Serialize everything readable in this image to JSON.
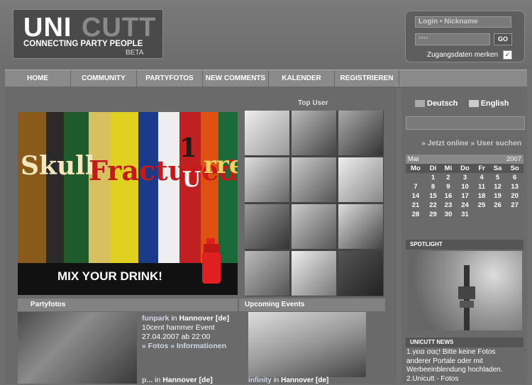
{
  "logo": {
    "uni": "UNI",
    "cutt": "CUTT",
    "tagline": "CONNECTING PARTY PEOPLE",
    "beta": "BETA"
  },
  "login": {
    "nickname_placeholder": "Login • Nickname",
    "password_value": "****",
    "go_label": "GO",
    "remember_label": "Zugangsdaten merken",
    "remember_checked": true
  },
  "nav": [
    "HOME",
    "COMMUNITY",
    "PARTYFOTOS",
    "NEW COMMENTS",
    "KALENDER",
    "REGISTRIEREN"
  ],
  "banner": {
    "text": "MIX YOUR DRINK!",
    "brands": [
      "Skull",
      "Fractured",
      "1",
      "U",
      "rre"
    ]
  },
  "top_user": {
    "title": "Top User",
    "count": 12
  },
  "partyfotos": {
    "title": "Partyfotos",
    "entry1": {
      "name": "funpark",
      "in": "in",
      "city": "Hannover [de]",
      "event": "10cent hammer Event",
      "date": "27.04.2007 ab 22:00",
      "links": "» Fotos » Informationen"
    },
    "entry2": {
      "name": "p...",
      "in": "in",
      "city": "Hannover [de]"
    }
  },
  "events": {
    "title": "Upcoming Events",
    "caption_name": "infinity",
    "caption_in": "in",
    "caption_city": "Hannover [de]"
  },
  "lang": {
    "de": "Deutsch",
    "en": "English"
  },
  "sidebar_links": "» Jetzt online » User suchen",
  "calendar": {
    "month": "Mai",
    "year": "2007",
    "days": [
      "Mo",
      "Di",
      "Mi",
      "Do",
      "Fr",
      "Sa",
      "So"
    ],
    "weeks": [
      [
        "",
        "1",
        "2",
        "3",
        "4",
        "5",
        "6"
      ],
      [
        "7",
        "8",
        "9",
        "10",
        "11",
        "12",
        "13"
      ],
      [
        "14",
        "15",
        "16",
        "17",
        "18",
        "19",
        "20"
      ],
      [
        "21",
        "22",
        "23",
        "24",
        "25",
        "26",
        "27"
      ],
      [
        "28",
        "29",
        "30",
        "31",
        "",
        "",
        ""
      ]
    ]
  },
  "spotlight": {
    "title": "SPOTLIGHT"
  },
  "news": {
    "title": "UNICUTT NEWS",
    "items": [
      "1.γεια σας! Bitte keine Fotos anderer Portale oder mit Werbeeinblendung hochladen.",
      "2.Unicutt - Fotos"
    ]
  }
}
